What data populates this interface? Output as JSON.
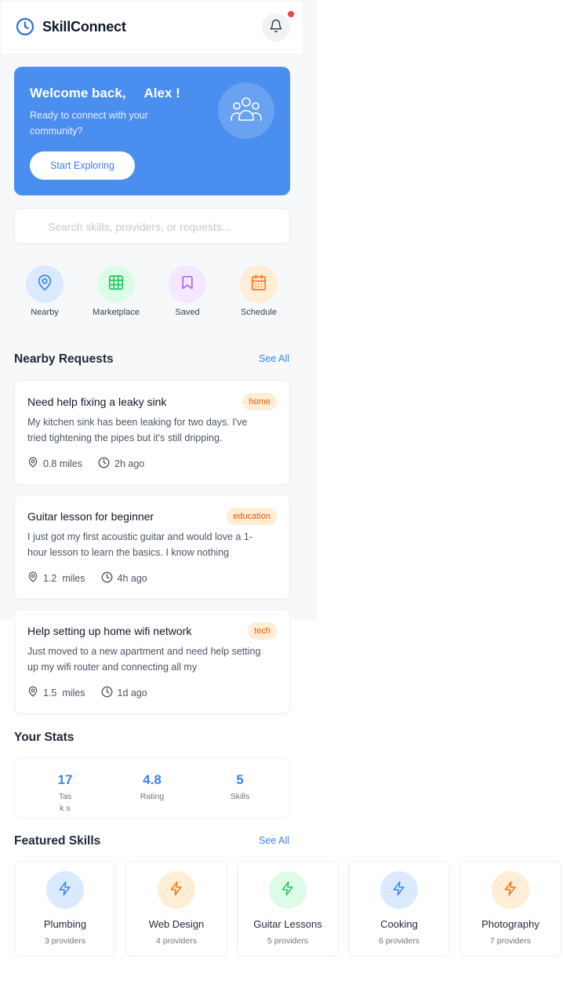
{
  "header": {
    "app_name": "SkillConnect"
  },
  "welcome": {
    "title": "Welcome back,     Alex !",
    "subtitle": "Ready to connect with your community?",
    "button": "Start Exploring"
  },
  "search": {
    "placeholder": "Search skills, providers, or requests..."
  },
  "quick_actions": [
    {
      "label": "Nearby",
      "icon": "map-pin-icon",
      "bg": "#dbeafe",
      "color": "#3b82f6"
    },
    {
      "label": "Marketplace",
      "icon": "grid-icon",
      "bg": "#dcfce7",
      "color": "#22c55e"
    },
    {
      "label": "Saved",
      "icon": "bookmark-icon",
      "bg": "#f3e8ff",
      "color": "#a855f7"
    },
    {
      "label": "Schedule",
      "icon": "calendar-icon",
      "bg": "#ffedd5",
      "color": "#f97316"
    }
  ],
  "nearby": {
    "title": "Nearby Requests",
    "see_all": "See All",
    "requests": [
      {
        "title": "Need help fixing a leaky sink",
        "tag": "home",
        "desc": "My kitchen sink has been leaking for two days. I've tried tightening the pipes but it's still dripping.",
        "distance": "0.8 miles",
        "time": "2h ago"
      },
      {
        "title": "Guitar lesson for beginner",
        "tag": "education",
        "desc": "I just got my first acoustic guitar and would love a 1-hour lesson to learn the basics. I know nothing",
        "distance": "1.2  miles",
        "time": "4h ago"
      },
      {
        "title": "Help setting up home wifi network",
        "tag": "tech",
        "desc": "Just moved to a new apartment and need help setting up my wifi router and connecting all my",
        "distance": "1.5  miles",
        "time": "1d ago"
      }
    ]
  },
  "stats": {
    "title": "Your Stats",
    "items": [
      {
        "value": "17",
        "label": "Task s"
      },
      {
        "value": "4.8",
        "label": "Rating"
      },
      {
        "value": "5",
        "label": "Skills"
      }
    ]
  },
  "featured": {
    "title": "Featured Skills",
    "see_all": "See All",
    "skills": [
      {
        "name": "Plumbing",
        "count": "3 providers",
        "bg": "#dbeafe",
        "color": "#3b82f6",
        "icon": "lightning-icon"
      },
      {
        "name": "Web Design",
        "count": "4 providers",
        "bg": "#ffedd5",
        "color": "#f97316",
        "icon": "lightning-icon"
      },
      {
        "name": "Guitar Lessons",
        "count": "5 providers",
        "bg": "#dcfce7",
        "color": "#22c55e",
        "icon": "lightning-icon"
      },
      {
        "name": "Cooking",
        "count": "6 providers",
        "bg": "#dbeafe",
        "color": "#3b82f6",
        "icon": "lightning-icon"
      },
      {
        "name": "Photography",
        "count": "7 providers",
        "bg": "#ffedd5",
        "color": "#f97316",
        "icon": "lightning-icon"
      }
    ]
  },
  "colors": {
    "accent": "#4a8ef0",
    "link": "#3b82f6",
    "tag_bg": "#ffedd5",
    "tag_text": "#ea580c"
  }
}
